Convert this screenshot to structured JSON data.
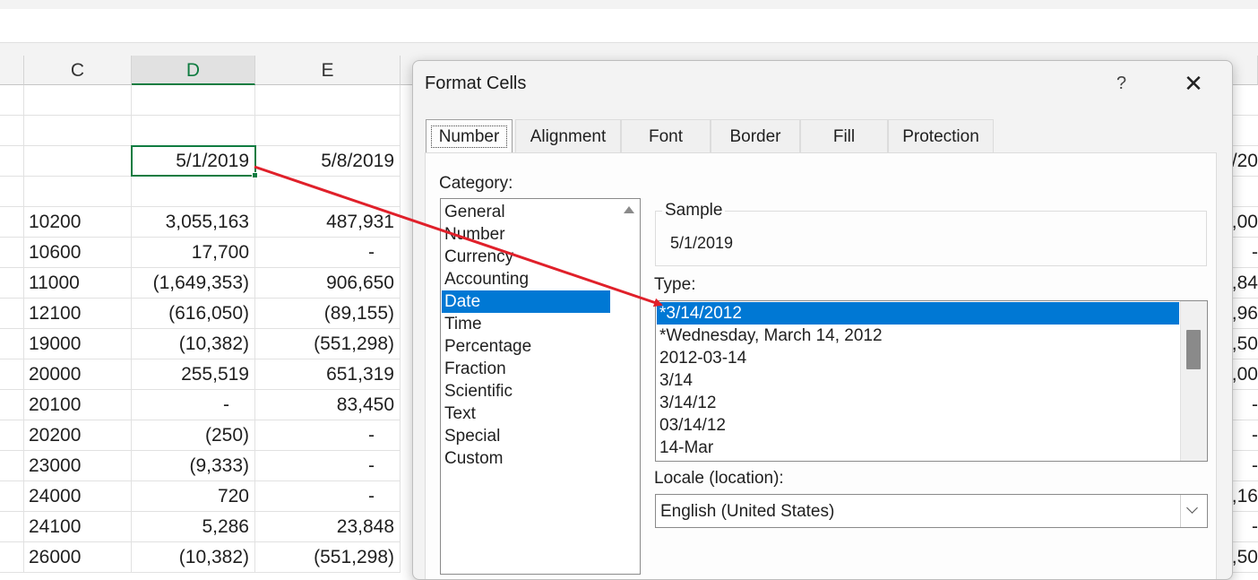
{
  "sheet": {
    "columns": [
      "C",
      "D",
      "E"
    ],
    "rows": [
      {
        "c": "",
        "d": "",
        "e": "",
        "edge": ""
      },
      {
        "c": "",
        "d": "",
        "e": "",
        "edge": ""
      },
      {
        "c": "",
        "d": "5/1/2019",
        "e": "5/8/2019",
        "edge": "/20"
      },
      {
        "c": "",
        "d": "",
        "e": "",
        "edge": ""
      },
      {
        "c": "10200",
        "d": "3,055,163",
        "e": "487,931",
        "edge": ",00"
      },
      {
        "c": "10600",
        "d": "17,700",
        "e": "-",
        "edge": "-"
      },
      {
        "c": "11000",
        "d": "(1,649,353)",
        "e": "906,650",
        "edge": ",84"
      },
      {
        "c": "12100",
        "d": "(616,050)",
        "e": "(89,155)",
        "edge": ",96"
      },
      {
        "c": "19000",
        "d": "(10,382)",
        "e": "(551,298)",
        "edge": ",50"
      },
      {
        "c": "20000",
        "d": "255,519",
        "e": "651,319",
        "edge": ",00"
      },
      {
        "c": "20100",
        "d": "-",
        "e": "83,450",
        "edge": "-"
      },
      {
        "c": "20200",
        "d": "(250)",
        "e": "-",
        "edge": "-"
      },
      {
        "c": "23000",
        "d": "(9,333)",
        "e": "-",
        "edge": "-"
      },
      {
        "c": "24000",
        "d": "720",
        "e": "-",
        "edge": ",16"
      },
      {
        "c": "24100",
        "d": "5,286",
        "e": "23,848",
        "edge": "-"
      },
      {
        "c": "26000",
        "d": "(10,382)",
        "e": "(551,298)",
        "edge": ",50"
      }
    ]
  },
  "dialog": {
    "title": "Format Cells",
    "help": "?",
    "close": "✕",
    "tabs": [
      "Number",
      "Alignment",
      "Font",
      "Border",
      "Fill",
      "Protection"
    ],
    "category_label": "Category:",
    "categories": [
      "General",
      "Number",
      "Currency",
      "Accounting",
      "Date",
      "Time",
      "Percentage",
      "Fraction",
      "Scientific",
      "Text",
      "Special",
      "Custom"
    ],
    "selected_category": "Date",
    "sample_label": "Sample",
    "sample_value": "5/1/2019",
    "type_label": "Type:",
    "types": [
      "*3/14/2012",
      "*Wednesday, March 14, 2012",
      "2012-03-14",
      "3/14",
      "3/14/12",
      "03/14/12",
      "14-Mar"
    ],
    "selected_type": "*3/14/2012",
    "locale_label": "Locale (location):",
    "locale_value": "English (United States)"
  },
  "colors": {
    "accent_green": "#107c41",
    "selection_blue": "#0078d4",
    "annotation_red": "#e0202a"
  }
}
